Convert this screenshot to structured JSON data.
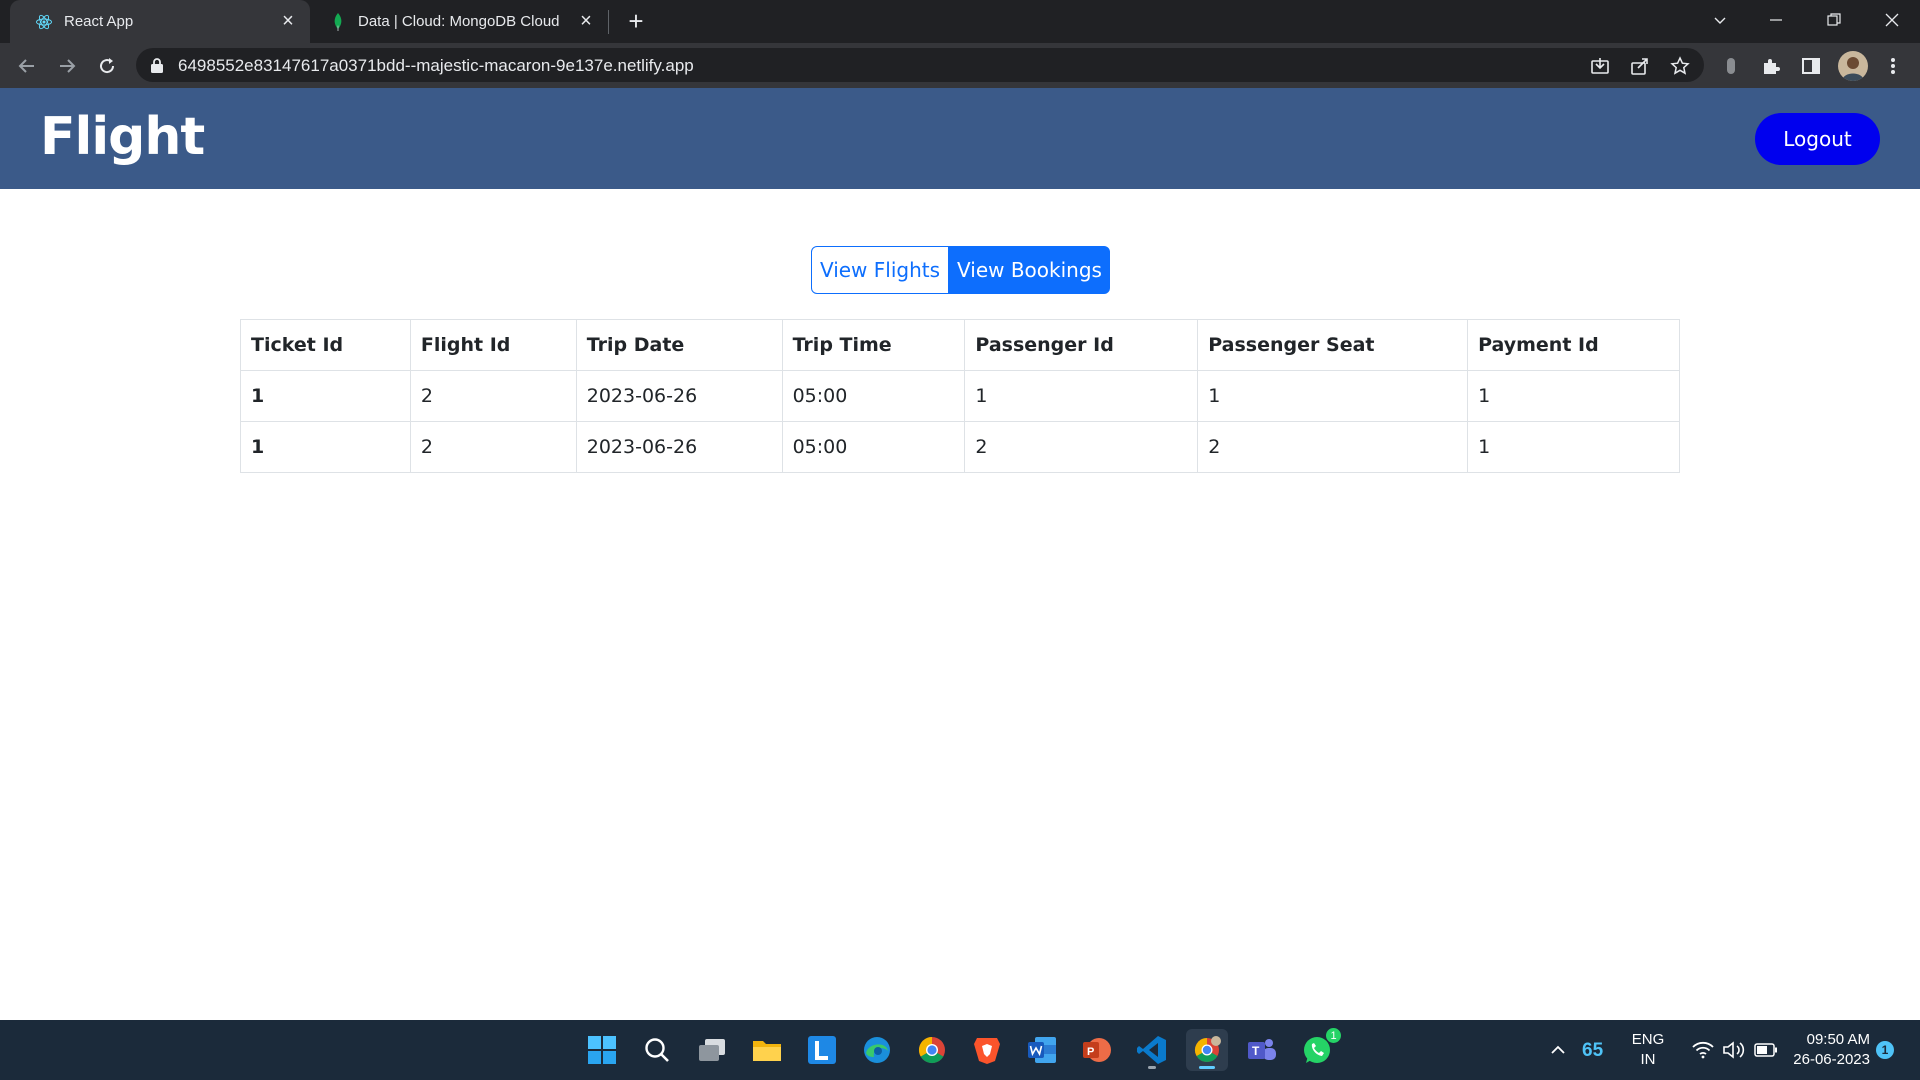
{
  "browser": {
    "tabs": [
      {
        "title": "React App",
        "active": true,
        "icon": "react-icon"
      },
      {
        "title": "Data | Cloud: MongoDB Cloud",
        "active": false,
        "icon": "mongodb-leaf-icon"
      }
    ],
    "url": "6498552e83147617a0371bdd--majestic-macaron-9e137e.netlify.app"
  },
  "header": {
    "brand": "Flight",
    "logout_label": "Logout"
  },
  "toggle": {
    "view_flights_label": "View Flights",
    "view_bookings_label": "View Bookings",
    "selected": "View Bookings"
  },
  "table": {
    "columns": [
      "Ticket Id",
      "Flight Id",
      "Trip Date",
      "Trip Time",
      "Passenger Id",
      "Passenger Seat",
      "Payment Id"
    ],
    "rows": [
      [
        "1",
        "2",
        "2023-06-26",
        "05:00",
        "1",
        "1",
        "1"
      ],
      [
        "1",
        "2",
        "2023-06-26",
        "05:00",
        "2",
        "2",
        "1"
      ]
    ]
  },
  "taskbar": {
    "apps": [
      "windows-start-icon",
      "search-icon",
      "task-view-icon",
      "file-explorer-icon",
      "l-app-icon",
      "edge-icon",
      "chrome-icon",
      "brave-icon",
      "word-icon",
      "powerpoint-icon",
      "vscode-icon",
      "chrome-profile-icon",
      "teams-icon",
      "whatsapp-icon"
    ],
    "whatsapp_badge": "1",
    "temperature": "65",
    "language": "ENG",
    "region": "IN",
    "time": "09:50 AM",
    "date": "26-06-2023",
    "notification_count": "1"
  },
  "colors": {
    "header_bg": "#3b5a89",
    "logout_bg": "#0000ee",
    "primary": "#0d6efd",
    "chrome_dark": "#202124",
    "taskbar_bg": "#1b2a3a"
  }
}
